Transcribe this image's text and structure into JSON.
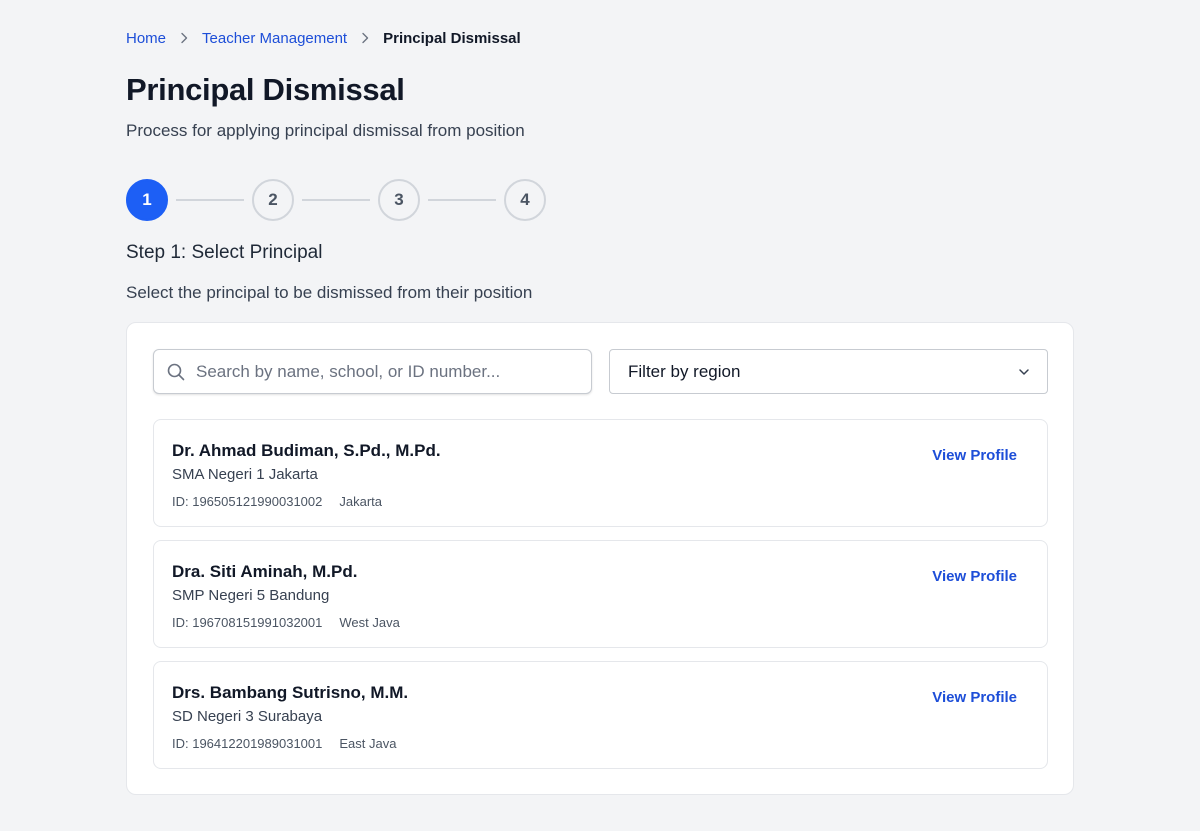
{
  "breadcrumb": {
    "home": "Home",
    "teacher_management": "Teacher Management",
    "current": "Principal Dismissal"
  },
  "page": {
    "title": "Principal Dismissal",
    "subtitle": "Process for applying principal dismissal from position"
  },
  "stepper": {
    "steps": [
      "1",
      "2",
      "3",
      "4"
    ],
    "active_index": 0,
    "active_color": "#1d5ff5"
  },
  "step": {
    "heading": "Step 1: Select Principal",
    "description": "Select the principal to be dismissed from their position"
  },
  "search": {
    "placeholder": "Search by name, school, or ID number...",
    "value": "",
    "icon": "search-icon"
  },
  "filter": {
    "selected": "Filter by region",
    "icon": "chevron-down-icon"
  },
  "principals": [
    {
      "name": "Dr. Ahmad Budiman, S.Pd., M.Pd.",
      "school": "SMA Negeri 1 Jakarta",
      "id": "ID: 196505121990031002",
      "region": "Jakarta",
      "action": "View Profile"
    },
    {
      "name": "Dra. Siti Aminah, M.Pd.",
      "school": "SMP Negeri 5 Bandung",
      "id": "ID: 196708151991032001",
      "region": "West Java",
      "action": "View Profile"
    },
    {
      "name": "Drs. Bambang Sutrisno, M.M.",
      "school": "SD Negeri 3 Surabaya",
      "id": "ID: 196412201989031001",
      "region": "East Java",
      "action": "View Profile"
    }
  ],
  "colors": {
    "link": "#1d4ed8",
    "background": "#f3f4f6"
  }
}
